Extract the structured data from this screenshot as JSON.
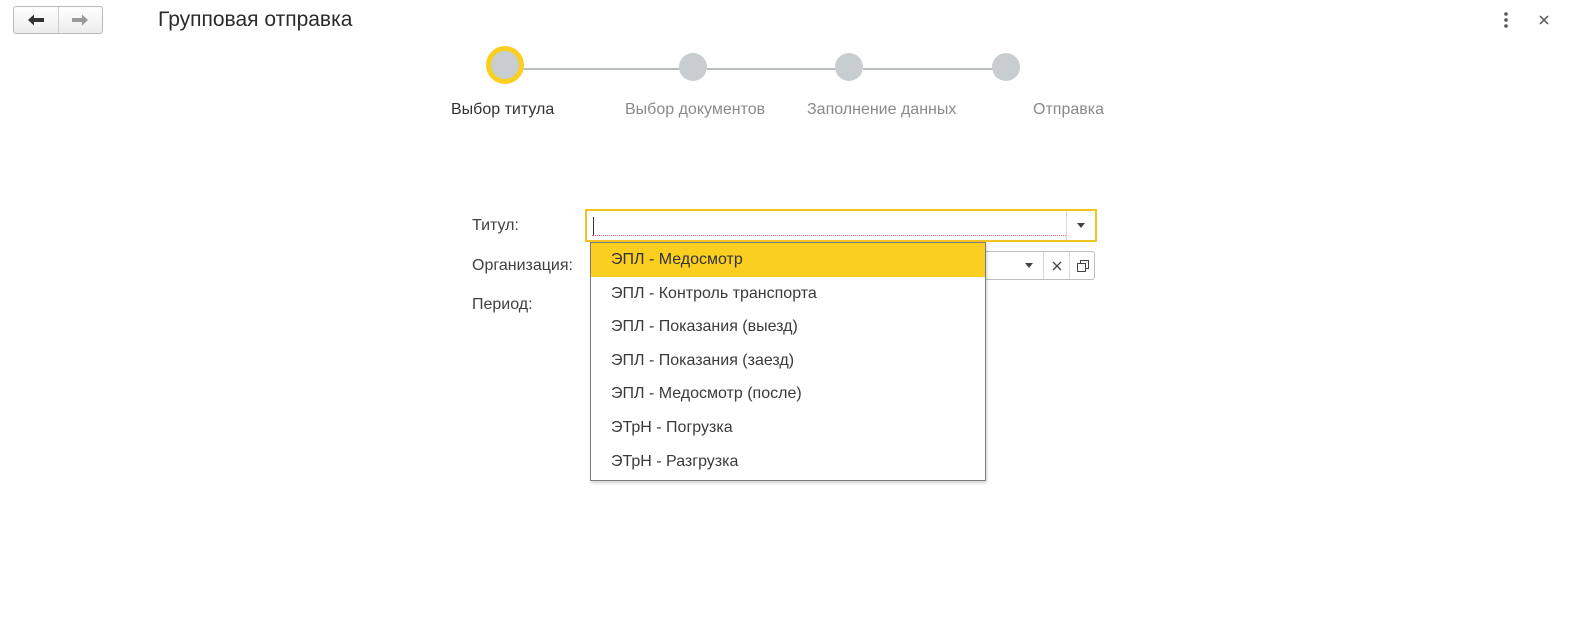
{
  "window": {
    "title": "Групповая отправка"
  },
  "icons": {
    "back": "arrow-left-icon",
    "forward": "arrow-right-icon",
    "menu": "vertical-dots-icon",
    "close": "close-icon"
  },
  "stepper": {
    "steps": [
      {
        "label": "Выбор титула",
        "active": true
      },
      {
        "label": "Выбор документов",
        "active": false
      },
      {
        "label": "Заполнение данных",
        "active": false
      },
      {
        "label": "Отправка",
        "active": false
      }
    ]
  },
  "form": {
    "title_label": "Титул:",
    "title_value": "",
    "organization_label": "Организация:",
    "period_label": "Период:"
  },
  "dropdown": {
    "selected_index": 0,
    "items": [
      "ЭПЛ - Медосмотр",
      "ЭПЛ - Контроль транспорта",
      "ЭПЛ - Показания (выезд)",
      "ЭПЛ - Показания (заезд)",
      "ЭПЛ - Медосмотр (после)",
      "ЭТрН - Погрузка",
      "ЭТрН - Разгрузка"
    ]
  },
  "colors": {
    "accent": "#f9d022",
    "selected_item": "#fbce22",
    "step_inactive": "#c8cdcf",
    "step_line": "#b8bec0"
  }
}
